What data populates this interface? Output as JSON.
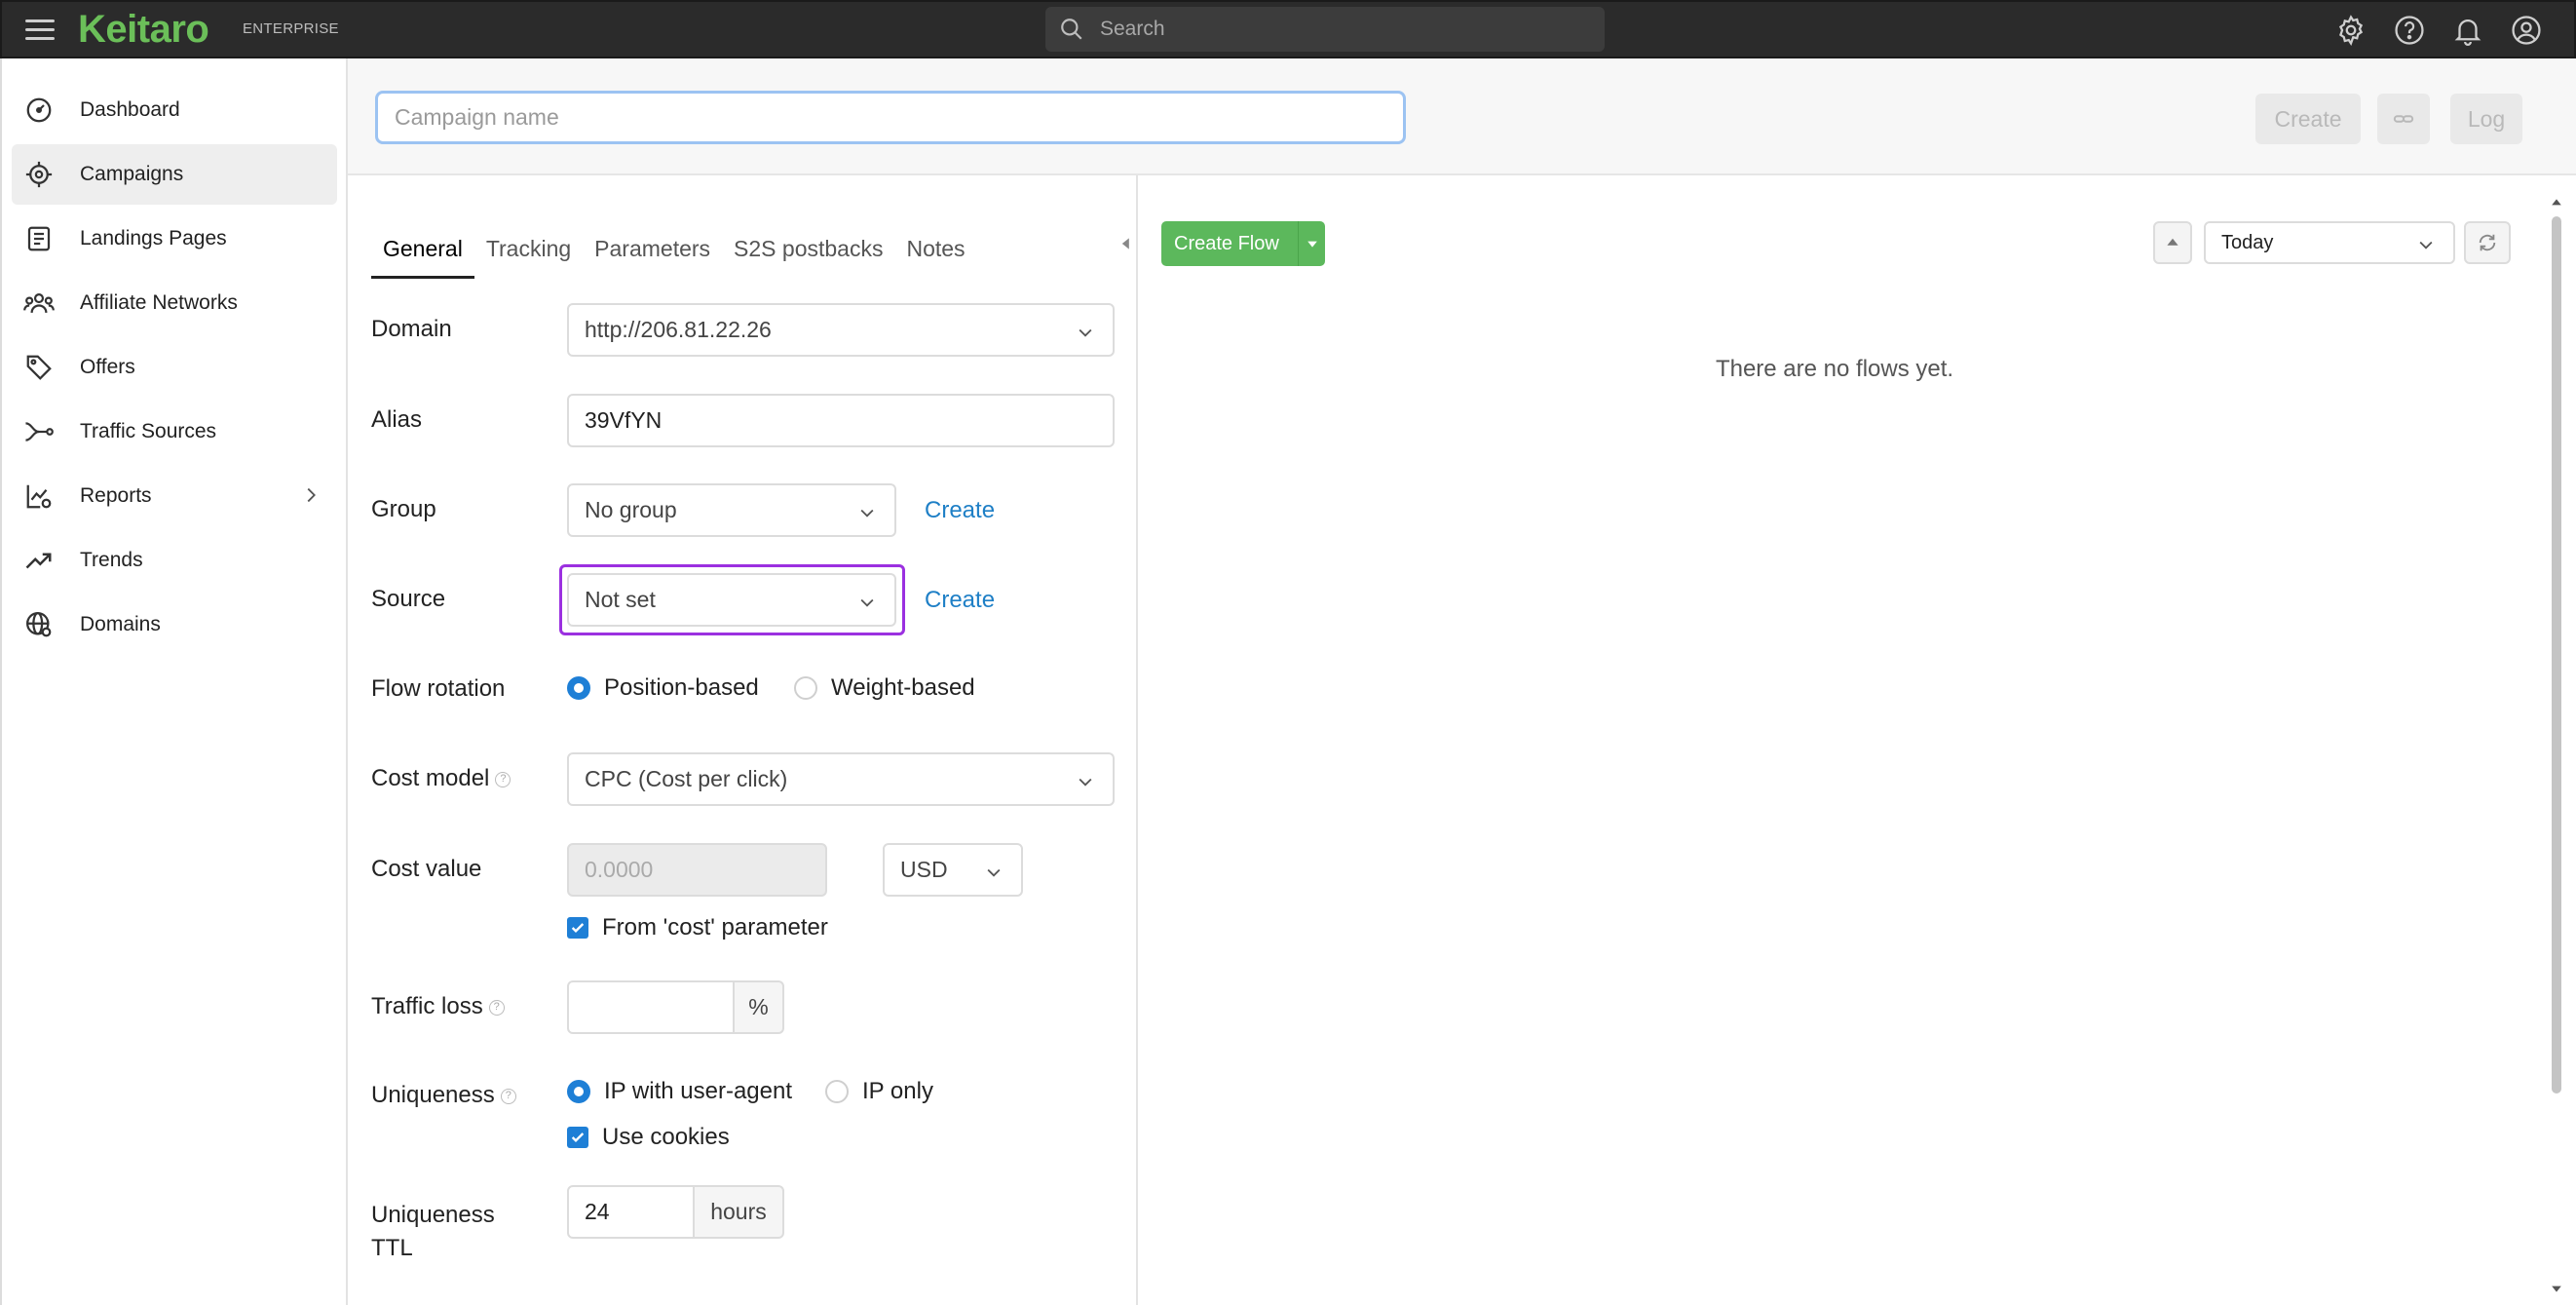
{
  "topbar": {
    "logo": "Keitaro",
    "logo_sub": "ENTERPRISE",
    "search_placeholder": "Search"
  },
  "sidebar": {
    "items": [
      {
        "label": "Dashboard",
        "icon": "dashboard-icon"
      },
      {
        "label": "Campaigns",
        "icon": "campaigns-icon",
        "active": true
      },
      {
        "label": "Landings Pages",
        "icon": "landing-pages-icon"
      },
      {
        "label": "Affiliate Networks",
        "icon": "affiliate-networks-icon"
      },
      {
        "label": "Offers",
        "icon": "offers-icon"
      },
      {
        "label": "Traffic Sources",
        "icon": "traffic-sources-icon"
      },
      {
        "label": "Reports",
        "icon": "reports-icon"
      },
      {
        "label": "Trends",
        "icon": "trends-icon"
      },
      {
        "label": "Domains",
        "icon": "domains-icon"
      }
    ]
  },
  "header": {
    "campaign_placeholder": "Campaign name",
    "create_label": "Create",
    "log_label": "Log"
  },
  "tabs": [
    "General",
    "Tracking",
    "Parameters",
    "S2S postbacks",
    "Notes"
  ],
  "form": {
    "domain_label": "Domain",
    "domain_value": "http://206.81.22.26",
    "alias_label": "Alias",
    "alias_value": "39VfYN",
    "group_label": "Group",
    "group_value": "No group",
    "group_create": "Create",
    "source_label": "Source",
    "source_value": "Not set",
    "source_create": "Create",
    "flow_rotation_label": "Flow rotation",
    "flow_rotation_opt1": "Position-based",
    "flow_rotation_opt2": "Weight-based",
    "cost_model_label": "Cost model",
    "cost_model_value": "CPC (Cost per click)",
    "cost_value_label": "Cost value",
    "cost_value_placeholder": "0.0000",
    "currency": "USD",
    "from_cost_param": "From 'cost' parameter",
    "traffic_loss_label": "Traffic loss",
    "traffic_loss_unit": "%",
    "uniqueness_label": "Uniqueness",
    "uniqueness_opt1": "IP with user-agent",
    "uniqueness_opt2": "IP only",
    "use_cookies": "Use cookies",
    "uniqueness_ttl_label_1": "Uniqueness",
    "uniqueness_ttl_label_2": "TTL",
    "uniqueness_ttl_value": "24",
    "uniqueness_ttl_unit": "hours"
  },
  "flows": {
    "create_flow": "Create Flow",
    "period": "Today",
    "empty": "There are no flows yet."
  },
  "colors": {
    "accent_green": "#5cb85c",
    "brand_green": "#6bbf59",
    "link_blue": "#1e7fc6",
    "focus_purple": "#9b30e0"
  }
}
